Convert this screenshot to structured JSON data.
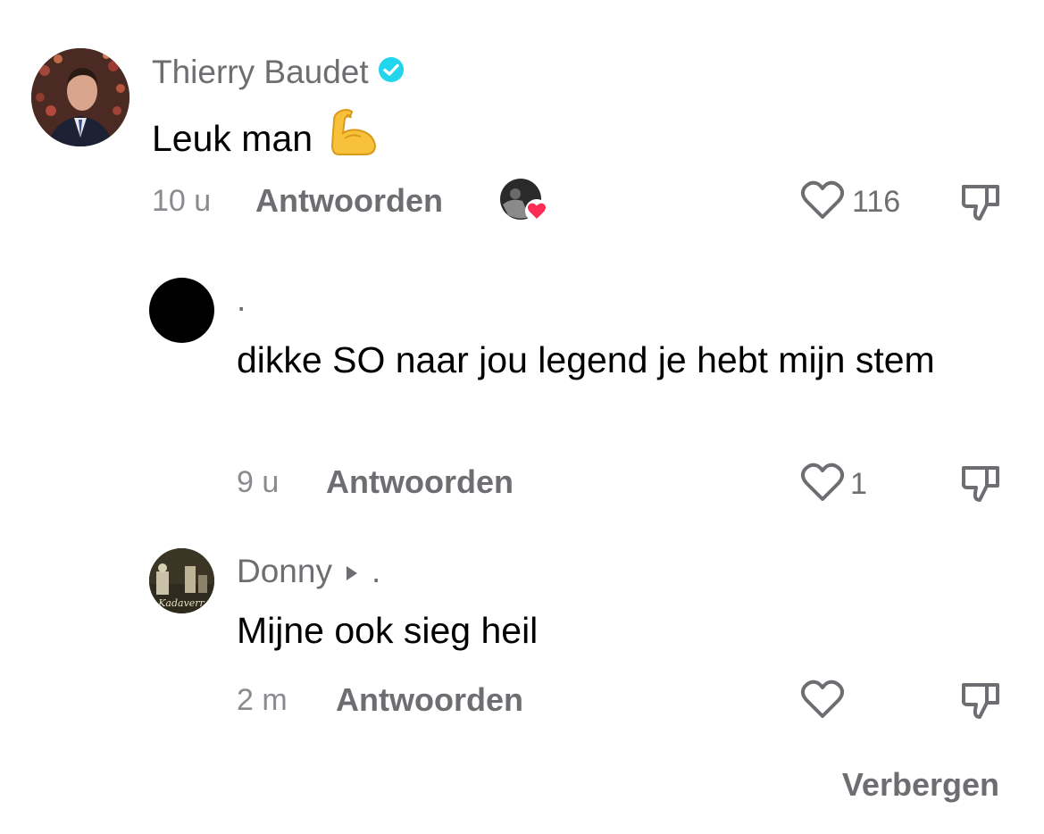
{
  "comments": [
    {
      "username": "Thierry Baudet",
      "verified": true,
      "text": "Leuk man",
      "emoji": "flexed-biceps",
      "time": "10 u",
      "reply_label": "Antwoorden",
      "liked_by_creator": true,
      "likes": "116"
    },
    {
      "username": ".",
      "text": "dikke SO naar jou legend je hebt mijn stem",
      "time": "9 u",
      "reply_label": "Antwoorden",
      "likes": "1"
    },
    {
      "username": "Donny",
      "reply_to": ".",
      "avatar_text": "Kadaverr",
      "text": "Mijne ook sieg heil",
      "time": "2 m",
      "reply_label": "Antwoorden",
      "likes": ""
    }
  ],
  "hide_label": "Verbergen",
  "colors": {
    "verified": "#20d5ec",
    "heart_badge": "#fe2c55",
    "muted_text": "#6e6e72"
  }
}
